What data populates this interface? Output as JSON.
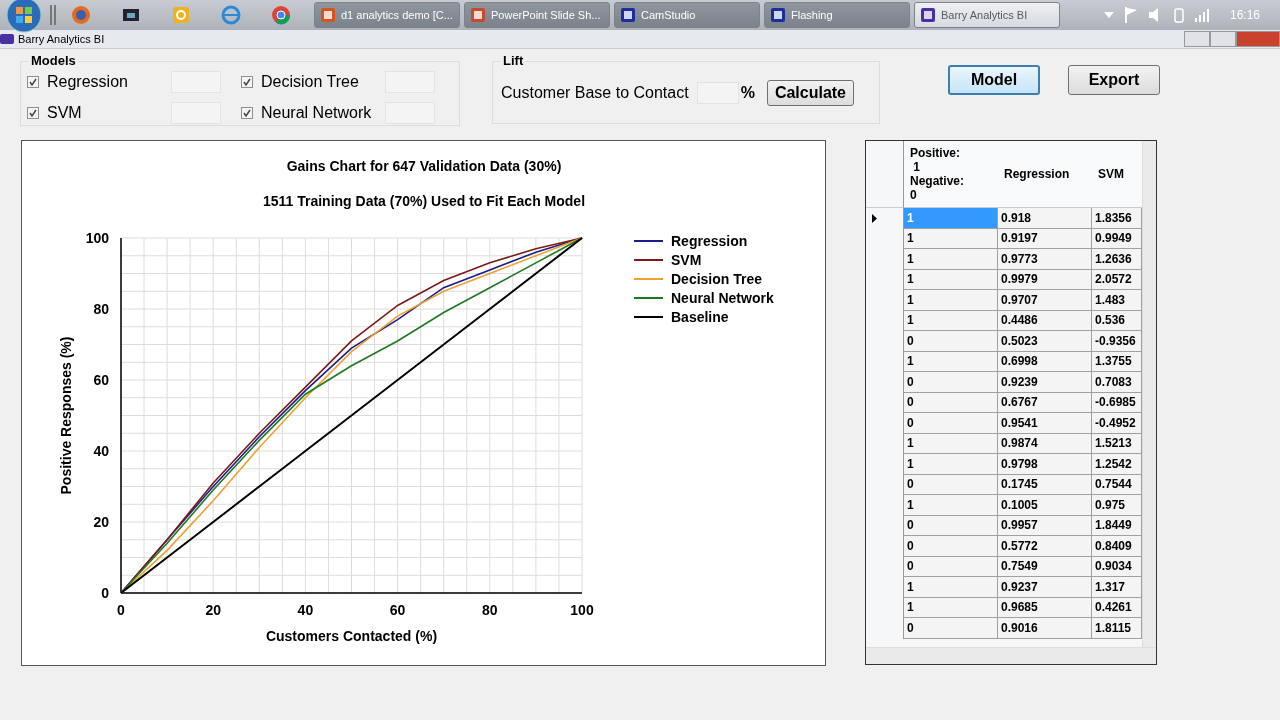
{
  "taskbar": {
    "tasks": [
      {
        "label": "d1 analytics demo [C...",
        "selected": false
      },
      {
        "label": "PowerPoint Slide Sh...",
        "selected": false
      },
      {
        "label": "CamStudio",
        "selected": false
      },
      {
        "label": "Flashing",
        "selected": false
      },
      {
        "label": "Barry Analytics BI",
        "selected": true
      }
    ],
    "clock": "16:16"
  },
  "window": {
    "title": "Barry Analytics BI"
  },
  "models": {
    "title": "Models",
    "items": [
      {
        "label": "Regression",
        "checked": true
      },
      {
        "label": "Decision Tree",
        "checked": true
      },
      {
        "label": "SVM",
        "checked": true
      },
      {
        "label": "Neural Network",
        "checked": true
      }
    ]
  },
  "lift": {
    "title": "Lift",
    "label": "Customer Base to Contact",
    "unit": "%",
    "button": "Calculate"
  },
  "buttons": [
    {
      "label": "Model",
      "selected": true
    },
    {
      "label": "Export",
      "selected": false
    }
  ],
  "chart": {
    "chart_data": {
      "type": "line",
      "title": "Gains Chart for 647 Validation Data (30%)",
      "subtitle": "1511 Training Data (70%) Used to Fit Each Model",
      "xlabel": "Customers Contacted (%)",
      "ylabel": "Positive Responses (%)",
      "x": [
        0,
        10,
        20,
        30,
        40,
        50,
        60,
        70,
        80,
        90,
        100
      ],
      "grid": true,
      "legend": "right",
      "xlim": [
        0,
        100
      ],
      "ylim": [
        0,
        100
      ],
      "xticks": [
        0,
        20,
        40,
        60,
        80,
        100
      ],
      "yticks": [
        0,
        20,
        40,
        60,
        80,
        100
      ],
      "series": [
        {
          "name": "Regression",
          "color": "#1c1c8c",
          "values": [
            0,
            15,
            30,
            44,
            57,
            69,
            77,
            86,
            91,
            96,
            100
          ]
        },
        {
          "name": "SVM",
          "color": "#7a1a1a",
          "values": [
            0,
            15,
            31,
            45,
            58,
            71,
            81,
            88,
            93,
            97,
            100
          ]
        },
        {
          "name": "Decision Tree",
          "color": "#f0a030",
          "values": [
            0,
            12,
            26,
            41,
            55,
            68,
            78,
            85,
            90,
            95,
            100
          ]
        },
        {
          "name": "Neural Network",
          "color": "#1e7a1e",
          "values": [
            0,
            14,
            29,
            43,
            56,
            64,
            71,
            79,
            86,
            93,
            100
          ]
        },
        {
          "name": "Baseline",
          "color": "#000000",
          "values": [
            0,
            10,
            20,
            30,
            40,
            50,
            60,
            70,
            80,
            90,
            100
          ]
        }
      ]
    }
  },
  "table": {
    "columns": [
      "Positive:\n 1\nNegative:\n0",
      "Regression",
      "SVM"
    ],
    "rows": [
      {
        "cells": [
          "1",
          "0.918",
          "1.8356"
        ],
        "selected": true
      },
      {
        "cells": [
          "1",
          "0.9197",
          "0.9949"
        ],
        "selected": false
      },
      {
        "cells": [
          "1",
          "0.9773",
          "1.2636"
        ],
        "selected": false
      },
      {
        "cells": [
          "1",
          "0.9979",
          "2.0572"
        ],
        "selected": false
      },
      {
        "cells": [
          "1",
          "0.9707",
          "1.483"
        ],
        "selected": false
      },
      {
        "cells": [
          "1",
          "0.4486",
          "0.536"
        ],
        "selected": false
      },
      {
        "cells": [
          "0",
          "0.5023",
          "-0.9356"
        ],
        "selected": false
      },
      {
        "cells": [
          "1",
          "0.6998",
          "1.3755"
        ],
        "selected": false
      },
      {
        "cells": [
          "0",
          "0.9239",
          "0.7083"
        ],
        "selected": false
      },
      {
        "cells": [
          "0",
          "0.6767",
          "-0.6985"
        ],
        "selected": false
      },
      {
        "cells": [
          "0",
          "0.9541",
          "-0.4952"
        ],
        "selected": false
      },
      {
        "cells": [
          "1",
          "0.9874",
          "1.5213"
        ],
        "selected": false
      },
      {
        "cells": [
          "1",
          "0.9798",
          "1.2542"
        ],
        "selected": false
      },
      {
        "cells": [
          "0",
          "0.1745",
          "0.7544"
        ],
        "selected": false
      },
      {
        "cells": [
          "1",
          "0.1005",
          "0.975"
        ],
        "selected": false
      },
      {
        "cells": [
          "0",
          "0.9957",
          "1.8449"
        ],
        "selected": false
      },
      {
        "cells": [
          "0",
          "0.5772",
          "0.8409"
        ],
        "selected": false
      },
      {
        "cells": [
          "0",
          "0.7549",
          "0.9034"
        ],
        "selected": false
      },
      {
        "cells": [
          "1",
          "0.9237",
          "1.317"
        ],
        "selected": false
      },
      {
        "cells": [
          "1",
          "0.9685",
          "0.4261"
        ],
        "selected": false
      },
      {
        "cells": [
          "0",
          "0.9016",
          "1.8115"
        ],
        "selected": false
      }
    ]
  }
}
